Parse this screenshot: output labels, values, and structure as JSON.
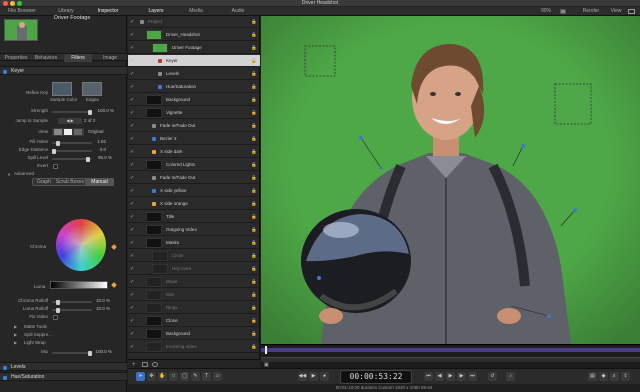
{
  "window": {
    "title": "Driver Headshot"
  },
  "top_tabs": [
    "File Browser",
    "Library",
    "Inspector",
    "Layers",
    "Media",
    "Audio"
  ],
  "toolbar": {
    "zoom": "90%",
    "render": "Render",
    "view": "View"
  },
  "preview": {
    "title": "Driver Footage"
  },
  "inspector_tabs": [
    "Properties",
    "Behaviors",
    "Filters",
    "Image"
  ],
  "keyer": {
    "section": "Keyer",
    "refine_key": "Refine Key",
    "sample_color": "Sample Color",
    "edges": "Edges",
    "strength_label": "Strength",
    "strength_value": "100.0 %",
    "jump_label": "Jump to Sample",
    "jump_value": "2 of 2",
    "view_label": "View",
    "view_value": "Original",
    "fill_holes_label": "Fill Holes",
    "fill_holes_value": "1.92",
    "edge_distance_label": "Edge Distance",
    "edge_distance_value": "0.0",
    "spill_level_label": "Spill Level",
    "spill_level_value": "95.0 %",
    "invert_label": "Invert",
    "advanced_label": "Advanced",
    "graph_tab": "Graph",
    "scrub_boxes_tab": "Scrub Boxes",
    "manual_tab": "Manual",
    "chroma_label": "Chroma",
    "luma_label": "Luma",
    "chroma_rolloff_label": "Chroma Rolloff",
    "chroma_rolloff_value": "10.0 %",
    "luma_rolloff_label": "Luma Rolloff",
    "luma_rolloff_value": "10.0 %",
    "fix_video_label": "Fix Video",
    "matte_tools_label": "Matte Tools",
    "spill_suppress_label": "Spill Suppre...",
    "light_wrap_label": "Light Wrap",
    "mix_label": "Mix",
    "mix_value": "100.0 %"
  },
  "levels": {
    "section": "Levels"
  },
  "hue_saturation": {
    "section": "Hue/Saturation"
  },
  "layers": [
    {
      "name": "Project",
      "indent": 0,
      "selected": false,
      "thumb": false,
      "dim": true
    },
    {
      "name": "Driver_Headshot",
      "indent": 1,
      "selected": false,
      "thumb": true,
      "dim": false
    },
    {
      "name": "Driver Footage",
      "indent": 2,
      "selected": false,
      "thumb": true,
      "dim": false
    },
    {
      "name": "Keyer",
      "indent": 3,
      "selected": true,
      "thumb": false,
      "dim": false
    },
    {
      "name": "Levels",
      "indent": 3,
      "selected": false,
      "thumb": false,
      "dim": false
    },
    {
      "name": "Hue/Saturation",
      "indent": 3,
      "selected": false,
      "thumb": false,
      "dim": false
    },
    {
      "name": "Background",
      "indent": 1,
      "selected": false,
      "thumb": true,
      "dim": false
    },
    {
      "name": "Vignette",
      "indent": 1,
      "selected": false,
      "thumb": true,
      "dim": false
    },
    {
      "name": "Fade In/Fade Out",
      "indent": 2,
      "selected": false,
      "thumb": false,
      "dim": false
    },
    {
      "name": "Bezier 2",
      "indent": 2,
      "selected": false,
      "thumb": false,
      "dim": false
    },
    {
      "name": "X side dark",
      "indent": 2,
      "selected": false,
      "thumb": false,
      "dim": false
    },
    {
      "name": "Colored Lights",
      "indent": 1,
      "selected": false,
      "thumb": true,
      "dim": false
    },
    {
      "name": "Fade In/Fade Out",
      "indent": 2,
      "selected": false,
      "thumb": false,
      "dim": false
    },
    {
      "name": "X side yellow",
      "indent": 2,
      "selected": false,
      "thumb": false,
      "dim": false
    },
    {
      "name": "X side orange",
      "indent": 2,
      "selected": false,
      "thumb": false,
      "dim": false
    },
    {
      "name": "Title",
      "indent": 1,
      "selected": false,
      "thumb": true,
      "dim": false
    },
    {
      "name": "Outgoing Video",
      "indent": 1,
      "selected": false,
      "thumb": true,
      "dim": false
    },
    {
      "name": "Masks",
      "indent": 1,
      "selected": false,
      "thumb": true,
      "dim": false
    },
    {
      "name": "Circle",
      "indent": 2,
      "selected": false,
      "thumb": true,
      "dim": true
    },
    {
      "name": "Hey Inset",
      "indent": 2,
      "selected": false,
      "thumb": true,
      "dim": true
    },
    {
      "name": "Wave",
      "indent": 1,
      "selected": false,
      "thumb": true,
      "dim": true
    },
    {
      "name": "Star",
      "indent": 1,
      "selected": false,
      "thumb": true,
      "dim": true
    },
    {
      "name": "Rings",
      "indent": 1,
      "selected": false,
      "thumb": true,
      "dim": true
    },
    {
      "name": "Clone",
      "indent": 1,
      "selected": false,
      "thumb": true,
      "dim": false
    },
    {
      "name": "Background",
      "indent": 1,
      "selected": false,
      "thumb": true,
      "dim": false
    },
    {
      "name": "Incoming Video",
      "indent": 1,
      "selected": false,
      "thumb": true,
      "dim": true
    }
  ],
  "transport": {
    "timecode": "00:00:53:22"
  },
  "status": {
    "text": "00:01:10;00 duration Custom 1920 x 1080 59.94"
  },
  "colors": {
    "canvas": "#4da646",
    "accent": "#3a7bd5",
    "selected_row": "#d3d3d3",
    "playhead": "#7a4fd6"
  }
}
